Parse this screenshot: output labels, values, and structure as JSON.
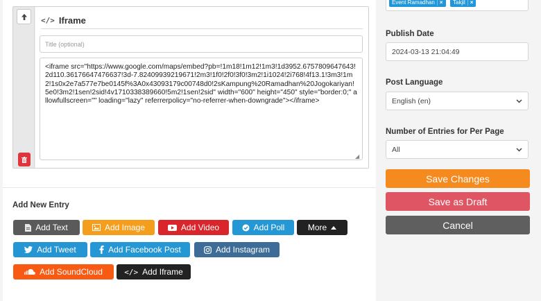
{
  "editor": {
    "block_title": "Iframe",
    "title_placeholder": "Title (optional)",
    "code": "<iframe src=\"https://www.google.com/maps/embed?pb=!1m18!1m12!1m3!1d3952.6757809647643!2d110.36176647476637!3d-7.82409939219671!2m3!1f0!2f0!3f0!3m2!1i1024!2i768!4f13.1!3m3!1m2!1s0x2e7a577e7be0145f%3A0x43093179c00748d0!2sKampung%20Ramadhan%20Jogokariyan!5e0!3m2!1sen!2sid!4v1710338389660!5m2!1sen!2sid\" width=\"600\" height=\"450\" style=\"border:0;\" allowfullscreen=\"\" loading=\"lazy\" referrerpolicy=\"no-referrer-when-downgrade\"></iframe>"
  },
  "add_entry": {
    "heading": "Add New Entry",
    "buttons": [
      {
        "label": "Add Text",
        "color": "#5a5a5a",
        "icon": "file-icon"
      },
      {
        "label": "Add Image",
        "color": "#f59d1c",
        "icon": "image-icon"
      },
      {
        "label": "Add Video",
        "color": "#d9262c",
        "icon": "youtube-icon"
      },
      {
        "label": "Add Poll",
        "color": "#2597d4",
        "icon": "check-circle-icon"
      },
      {
        "label": "More",
        "color": "#222222",
        "icon": "caret-up-icon"
      },
      {
        "label": "Add Tweet",
        "color": "#2596d3",
        "icon": "twitter-icon"
      },
      {
        "label": "Add Facebook Post",
        "color": "#2597d4",
        "icon": "facebook-icon"
      },
      {
        "label": "Add Instagram",
        "color": "#3c6c97",
        "icon": "instagram-icon"
      },
      {
        "label": "Add SoundCloud",
        "color": "#f95a13",
        "icon": "soundcloud-icon"
      },
      {
        "label": "Add Iframe",
        "color": "#222222",
        "icon": "code-icon"
      }
    ]
  },
  "sidebar": {
    "tags": [
      {
        "label": "Event Ramadhan"
      },
      {
        "label": "Takjil"
      }
    ],
    "tag_remove": "×",
    "publish_date_label": "Publish Date",
    "publish_date_value": "2024-03-13 21:04:49",
    "language_label": "Post Language",
    "language_value": "English (en)",
    "entries_label": "Number of Entries for Per Page",
    "entries_value": "All",
    "save_changes": "Save Changes",
    "save_draft": "Save as Draft",
    "cancel": "Cancel",
    "colors": {
      "save": "#f58a1f",
      "draft": "#e05563",
      "cancel": "#5f5f5f",
      "tag": "#2196d8"
    }
  }
}
